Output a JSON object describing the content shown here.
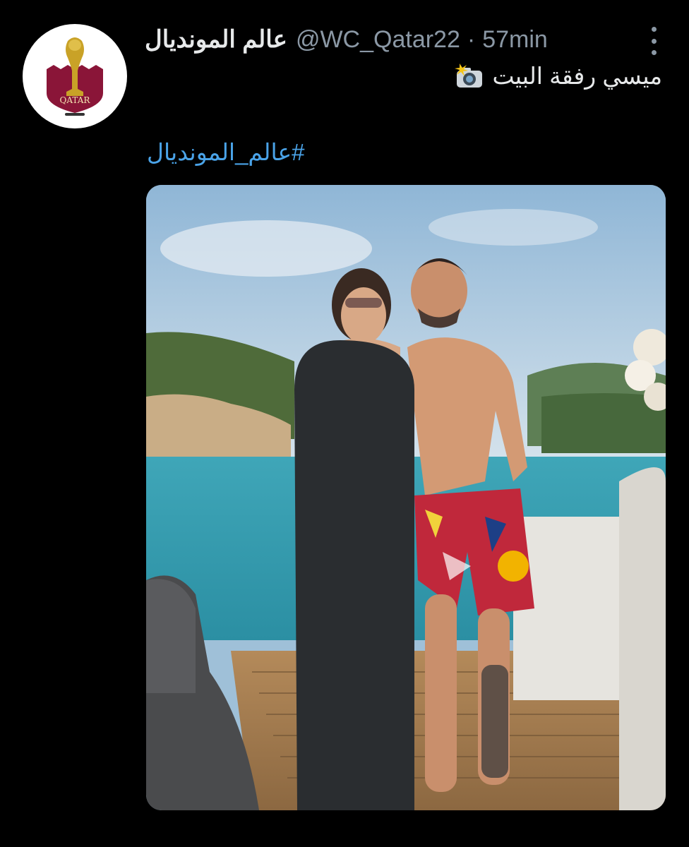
{
  "tweet": {
    "display_name": "عالم المونديال",
    "handle": "@WC_Qatar22",
    "separator": "·",
    "time": "57min",
    "text": "ميسي رفقة البيت",
    "hashtag": "#عالم_المونديال"
  },
  "avatar": {
    "icon": "world-cup-trophy-logo",
    "logo_text": "QATAR",
    "colors": {
      "maroon": "#8a1538",
      "gold": "#c9a227"
    }
  },
  "colors": {
    "background": "#000000",
    "link": "#4aa3e8",
    "muted": "#8b98a5",
    "text": "#e7e9ea"
  }
}
